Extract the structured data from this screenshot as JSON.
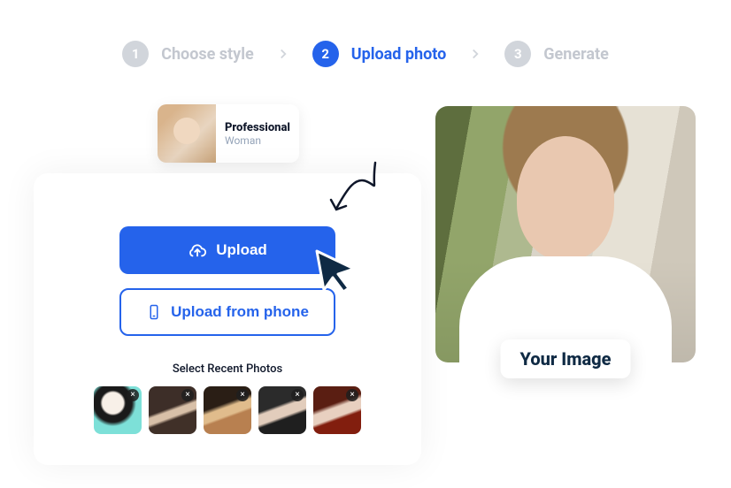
{
  "steps": {
    "s1": {
      "num": "1",
      "label": "Choose style"
    },
    "s2": {
      "num": "2",
      "label": "Upload photo"
    },
    "s3": {
      "num": "3",
      "label": "Generate"
    }
  },
  "style_card": {
    "title": "Professional",
    "subtitle": "Woman"
  },
  "upload": {
    "primary_label": "Upload",
    "secondary_label": "Upload from phone",
    "recent_label": "Select Recent Photos"
  },
  "preview": {
    "badge_label": "Your Image"
  },
  "icons": {
    "close": "×"
  }
}
